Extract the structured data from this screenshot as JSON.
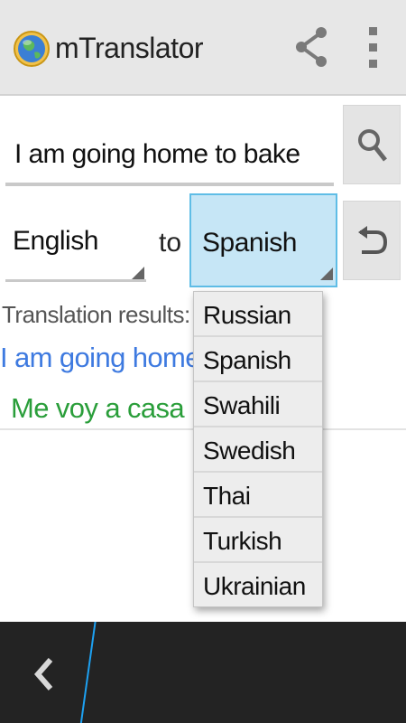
{
  "app": {
    "title": "mTranslator",
    "icon": "globe-icon"
  },
  "actionbar": {
    "share_icon": "share-icon",
    "overflow_icon": "overflow-menu-icon"
  },
  "input": {
    "value": "I am going home to bake",
    "search_icon": "search-icon"
  },
  "languages": {
    "from": "English",
    "to_word": "to",
    "to": "Spanish",
    "swap_icon": "swap-icon"
  },
  "results": {
    "label": "Translation results:",
    "source": "I am going home to ba",
    "target": "Me voy a casa para"
  },
  "dropdown": {
    "options": [
      "Russian",
      "Spanish",
      "Swahili",
      "Swedish",
      "Thai",
      "Turkish",
      "Ukrainian"
    ]
  },
  "colors": {
    "source_text": "#3e7ae0",
    "target_text": "#2a9e3a",
    "selected_spinner": "#c6e6f6",
    "accent": "#1da1f2"
  }
}
